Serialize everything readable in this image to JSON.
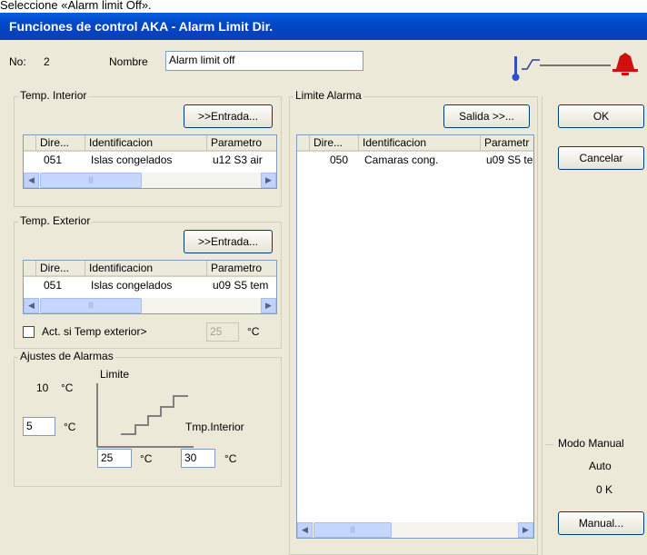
{
  "caption": "Seleccione «Alarm limit Off».",
  "window": {
    "title": "Funciones de control AKA - Alarm Limit Dir."
  },
  "header": {
    "no_label": "No:",
    "no_value": "2",
    "name_label": "Nombre",
    "name_value": "Alarm limit off"
  },
  "temp_interior": {
    "legend": "Temp. Interior",
    "input_button": ">>Entrada...",
    "columns": [
      "Dire...",
      "Identificacion",
      "Parametro"
    ],
    "rows": [
      {
        "dir": "051",
        "id": "Islas congelados",
        "param": "u12 S3 air"
      }
    ]
  },
  "temp_exterior": {
    "legend": "Temp. Exterior",
    "input_button": ">>Entrada...",
    "columns": [
      "Dire...",
      "Identificacion",
      "Parametro"
    ],
    "rows": [
      {
        "dir": "051",
        "id": "Islas congelados",
        "param": "u09 S5 tem"
      }
    ],
    "checkbox_label": "Act. si Temp exterior>",
    "checkbox_checked": false,
    "threshold_value": "25",
    "unit": "°C"
  },
  "alarm_settings": {
    "legend": "Ajustes de Alarmas",
    "limit_label": "Limite",
    "upper_value": "10",
    "unit": "°C",
    "lower_value": "5",
    "axis_label": "Tmp.Interior",
    "interior_low": "25",
    "interior_high": "30"
  },
  "alarm_limit": {
    "legend": "Limite Alarma",
    "output_button": "Salida >>...",
    "columns": [
      "Dire...",
      "Identificacion",
      "Parametr"
    ],
    "rows": [
      {
        "dir": "050",
        "id": "Camaras cong.",
        "param": "u09 S5 te"
      }
    ]
  },
  "buttons": {
    "ok": "OK",
    "cancel": "Cancelar",
    "manual": "Manual..."
  },
  "manual_mode": {
    "legend": "Modo Manual",
    "mode": "Auto",
    "value": "0 K"
  }
}
